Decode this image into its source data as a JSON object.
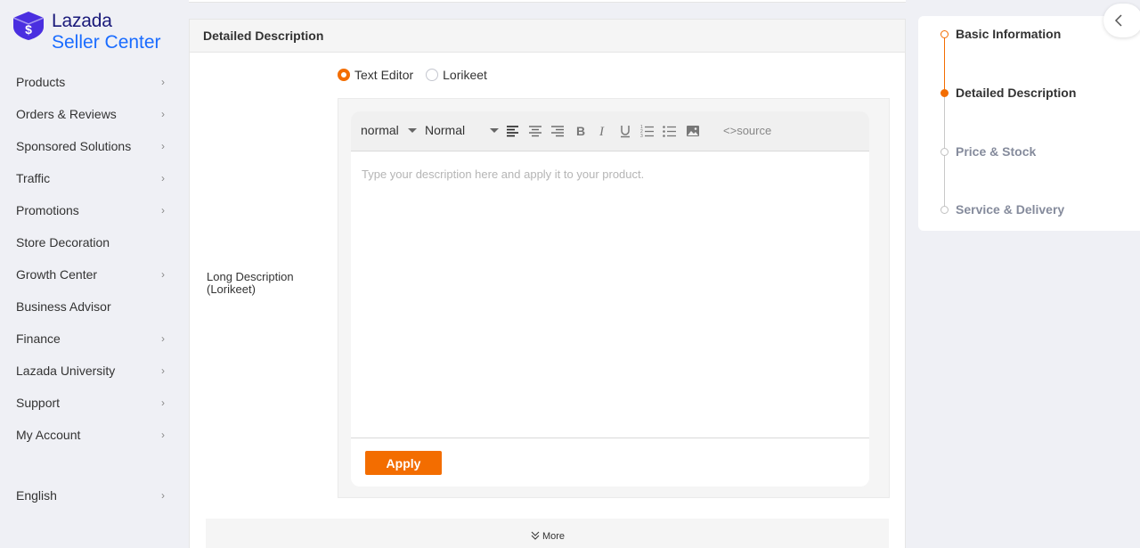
{
  "brand": {
    "line1": "Lazada",
    "line2": "Seller Center",
    "accent": "#f36d00",
    "logo_color": "#4a2fe0"
  },
  "sidebar": {
    "items": [
      {
        "label": "Products",
        "has_chevron": true
      },
      {
        "label": "Orders & Reviews",
        "has_chevron": true
      },
      {
        "label": "Sponsored Solutions",
        "has_chevron": true
      },
      {
        "label": "Traffic",
        "has_chevron": true
      },
      {
        "label": "Promotions",
        "has_chevron": true
      },
      {
        "label": "Store Decoration",
        "has_chevron": false
      },
      {
        "label": "Growth Center",
        "has_chevron": true
      },
      {
        "label": "Business Advisor",
        "has_chevron": false
      },
      {
        "label": "Finance",
        "has_chevron": true
      },
      {
        "label": "Lazada University",
        "has_chevron": true
      },
      {
        "label": "Support",
        "has_chevron": true
      },
      {
        "label": "My Account",
        "has_chevron": true
      }
    ],
    "language": "English"
  },
  "section": {
    "title": "Detailed Description",
    "radio_options": [
      {
        "label": "Text Editor",
        "selected": true
      },
      {
        "label": "Lorikeet",
        "selected": false
      }
    ],
    "field_label": "Long Description (Lorikeet)",
    "editor": {
      "font_size_select": "normal",
      "format_select": "Normal",
      "source_label": "source",
      "placeholder": "Type your description here and apply it to your product.",
      "toolbar_icons": [
        "align-left-icon",
        "align-center-icon",
        "align-right-icon",
        "bold-icon",
        "italic-icon",
        "underline-icon",
        "ordered-list-icon",
        "bullet-list-icon",
        "image-icon"
      ]
    },
    "apply_label": "Apply",
    "more_label": "More"
  },
  "steps": {
    "items": [
      {
        "label": "Basic Information",
        "state": "done"
      },
      {
        "label": "Detailed Description",
        "state": "current"
      },
      {
        "label": "Price & Stock",
        "state": "todo"
      },
      {
        "label": "Service & Delivery",
        "state": "todo"
      }
    ]
  }
}
